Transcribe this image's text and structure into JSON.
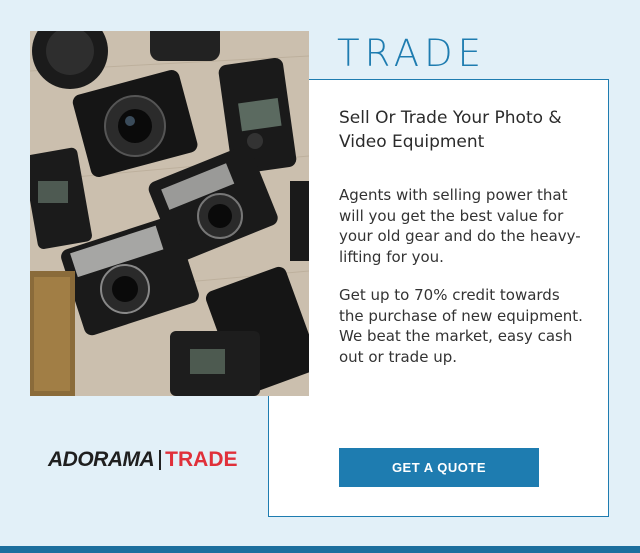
{
  "header": {
    "title": "TRADE"
  },
  "content": {
    "heading": "Sell Or Trade Your Photo & Video Equipment",
    "paragraph_1": "Agents with selling power that will you get the best value for your old gear and do the heavy-lifting for you.",
    "paragraph_2": "Get up to 70% credit towards the purchase of new equipment. We beat the market, easy cash out or trade up."
  },
  "cta": {
    "label": "GET A QUOTE"
  },
  "logo": {
    "brand": "ADORAMA",
    "sub": "TRADE"
  },
  "colors": {
    "background": "#e2f0f8",
    "accent": "#1e7cb0",
    "logo_red": "#e0303a",
    "bottom_bar": "#1c6f9e"
  }
}
